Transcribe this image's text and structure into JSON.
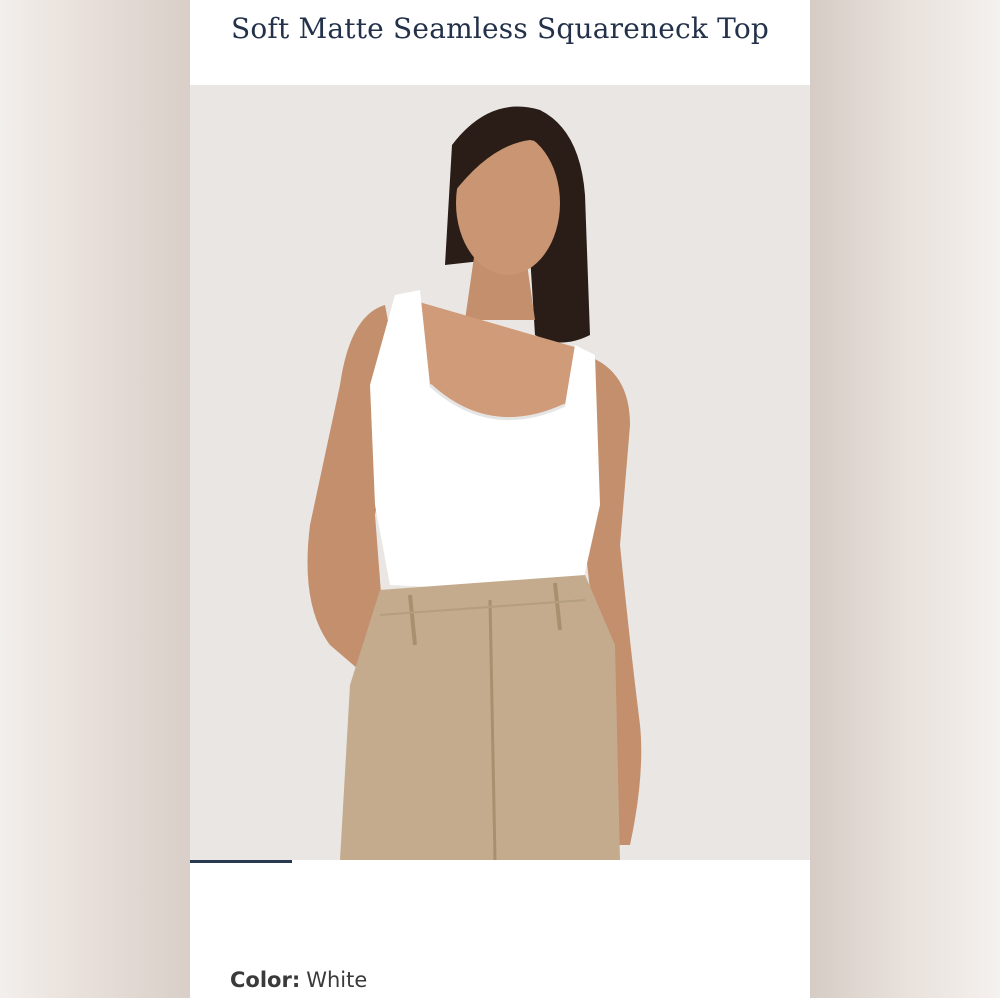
{
  "product": {
    "title": "Soft Matte Seamless Squareneck Top",
    "color_label": "Color:",
    "color_value": "White"
  },
  "carousel": {
    "progress": 0.165
  },
  "colors": {
    "title": "#23324a",
    "progress": "#2a3952",
    "photo_background": "#e9e6e3",
    "top": "#ffffff",
    "pants": "#c4ab8e",
    "skin": "#c38f6c",
    "hair": "#2a1d17"
  }
}
